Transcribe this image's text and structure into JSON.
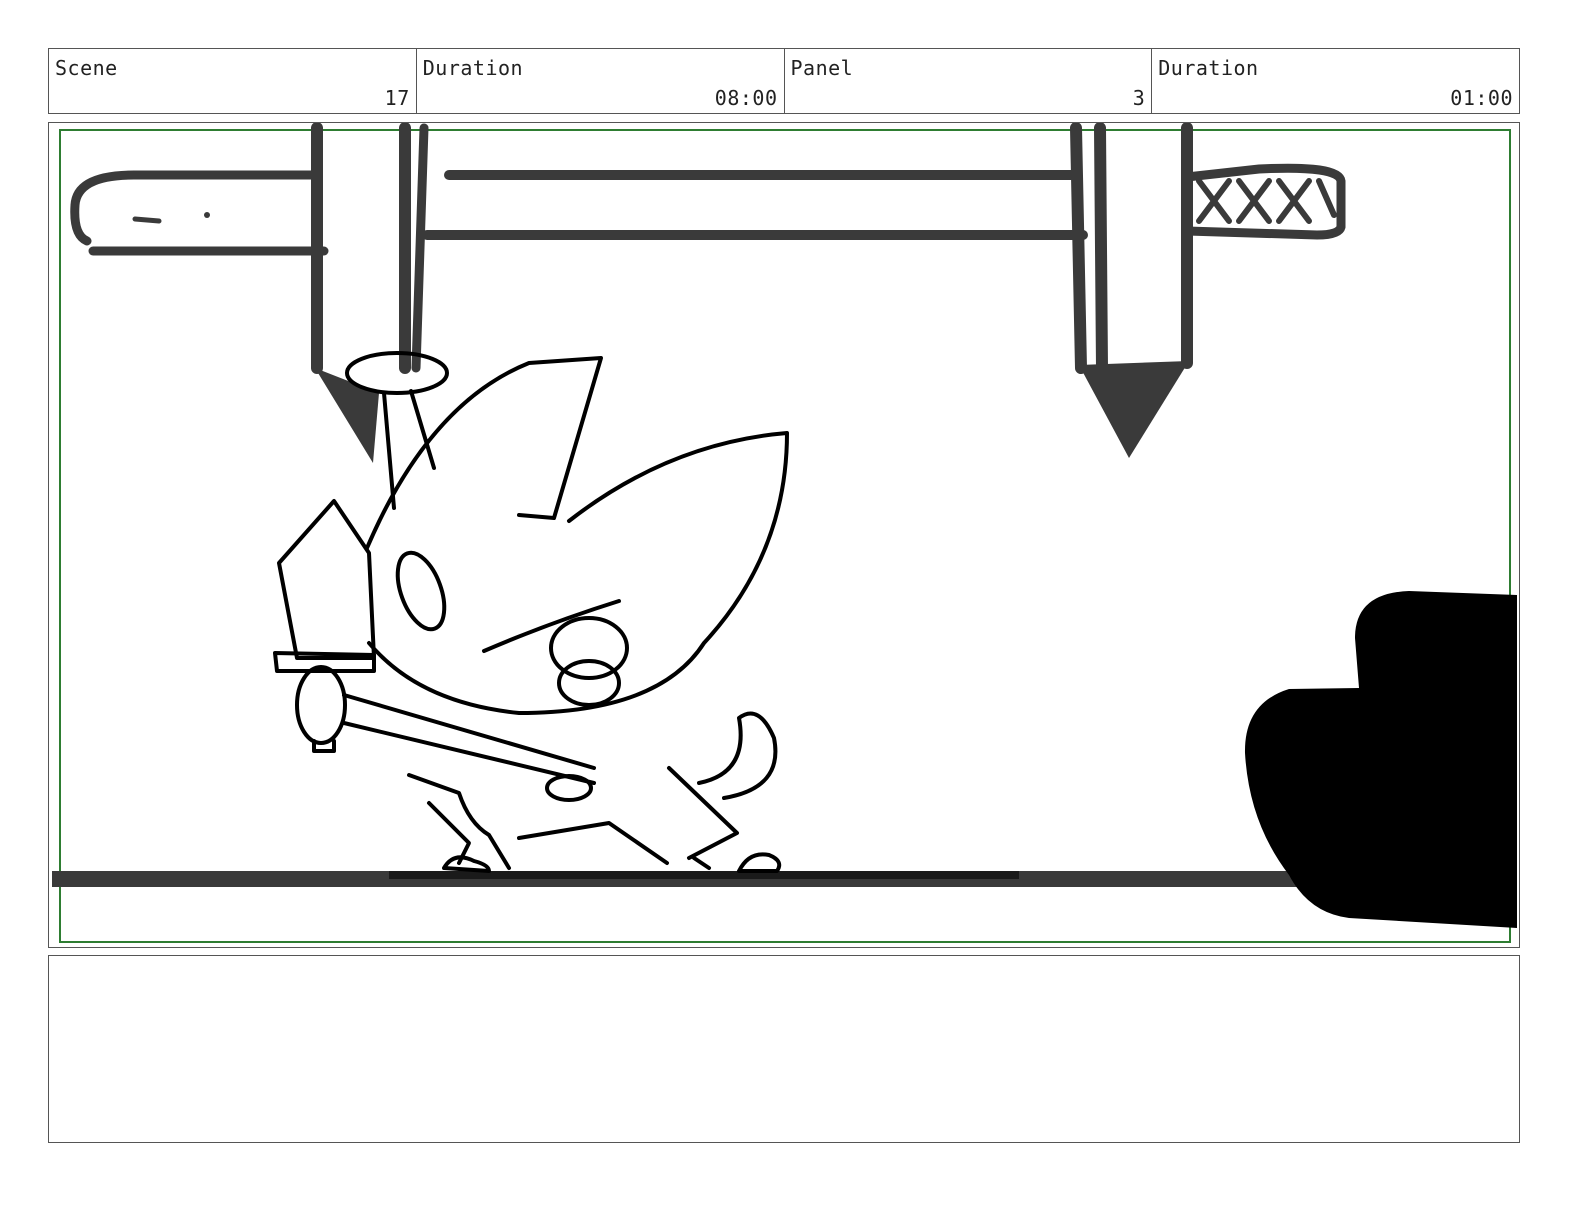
{
  "header": {
    "scene": {
      "label": "Scene",
      "value": "17"
    },
    "scene_duration": {
      "label": "Duration",
      "value": "08:00"
    },
    "panel": {
      "label": "Panel",
      "value": "3"
    },
    "panel_duration": {
      "label": "Duration",
      "value": "01:00"
    }
  },
  "frame": {
    "safe_area_color": "#2e7d32",
    "ink_color": "#3a3a3a"
  },
  "notes": {
    "text": ""
  }
}
